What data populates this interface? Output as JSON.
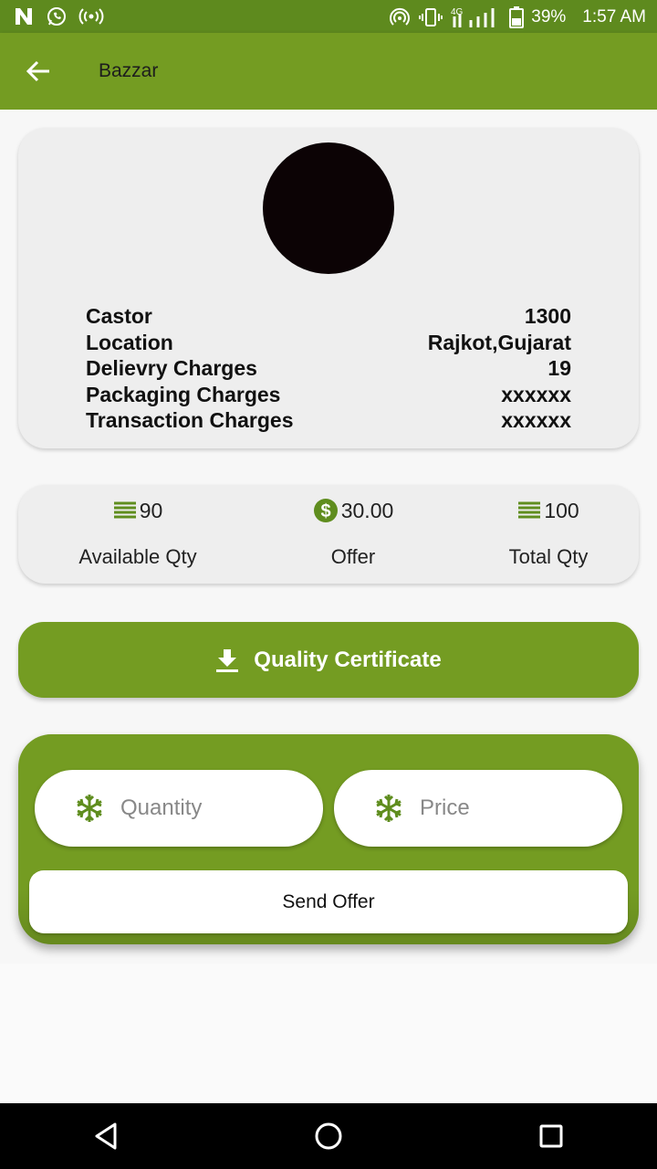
{
  "status_bar": {
    "battery": "39%",
    "time": "1:57 AM",
    "network": "4G",
    "left_icons": [
      "n-icon",
      "whatsapp-icon",
      "hotspot-icon"
    ],
    "right_icons": [
      "wifi-hotspot-icon",
      "vibrate-icon",
      "signal-icon",
      "battery-icon"
    ]
  },
  "app_bar": {
    "title": "Bazzar"
  },
  "product": {
    "rows": [
      {
        "label": "Castor",
        "value": "1300"
      },
      {
        "label": "Location",
        "value": "Rajkot,Gujarat"
      },
      {
        "label": "Delievry Charges",
        "value": "19"
      },
      {
        "label": "Packaging Charges",
        "value": "xxxxxx"
      },
      {
        "label": "Transaction Charges",
        "value": "xxxxxx"
      }
    ]
  },
  "stats": [
    {
      "value": "90",
      "label": "Available Qty",
      "icon": "list-icon"
    },
    {
      "value": "30.00",
      "label": "Offer",
      "icon": "dollar-icon"
    },
    {
      "value": "100",
      "label": "Total Qty",
      "icon": "list-icon"
    }
  ],
  "certificate_button": {
    "label": "Quality Certificate",
    "icon": "download-icon"
  },
  "offer_form": {
    "quantity_placeholder": "Quantity",
    "price_placeholder": "Price",
    "send_label": "Send Offer"
  },
  "colors": {
    "primary": "#749c22",
    "status_bar": "#5e8a1e",
    "icon_green": "#5f8d1e"
  }
}
